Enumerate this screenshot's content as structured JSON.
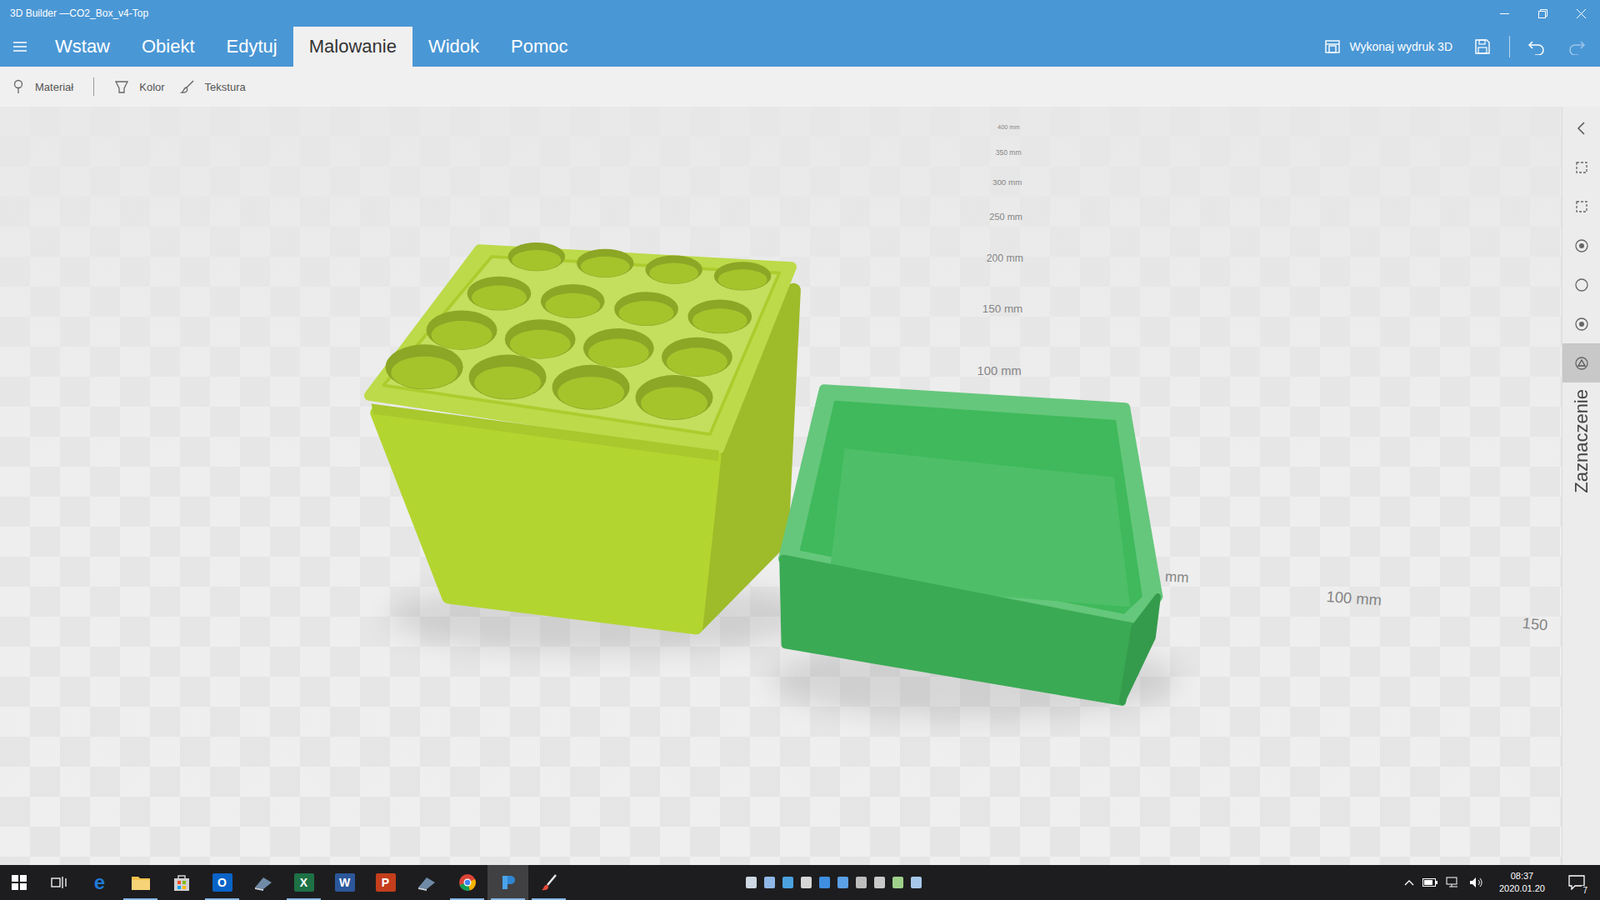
{
  "window": {
    "title": "3D Builder —CO2_Box_v4-Top"
  },
  "menu": {
    "tabs": [
      {
        "label": "Wstaw",
        "selected": false
      },
      {
        "label": "Obiekt",
        "selected": false
      },
      {
        "label": "Edytuj",
        "selected": false
      },
      {
        "label": "Malowanie",
        "selected": true
      },
      {
        "label": "Widok",
        "selected": false
      },
      {
        "label": "Pomoc",
        "selected": false
      }
    ],
    "print_button": "Wykonaj wydruk 3D",
    "undo": {
      "disabled": false
    },
    "redo": {
      "disabled": true
    }
  },
  "toolbar": {
    "items": [
      {
        "label": "Materiał"
      },
      {
        "label": "Kolor"
      },
      {
        "label": "Tekstura"
      }
    ]
  },
  "rulers": {
    "vertical": [
      "400 mm",
      "350 mm",
      "300 mm",
      "250 mm",
      "200 mm",
      "150 mm",
      "100 mm"
    ],
    "horizontal": [
      "mm",
      "100 mm",
      "150"
    ]
  },
  "scene": {
    "objects": [
      {
        "kind": "holder",
        "color": "#b3d530",
        "rows": 4,
        "cols": 4
      },
      {
        "kind": "lid",
        "color": "#3fb95b"
      }
    ]
  },
  "side_panel": {
    "tools": [
      {
        "selected": false
      },
      {
        "selected": false
      },
      {
        "selected": false
      },
      {
        "selected": false
      },
      {
        "selected": false
      },
      {
        "selected": true
      }
    ],
    "label": "Zaznaczenie"
  },
  "taskbar": {
    "apps": [
      {
        "kind": "windows",
        "running": false,
        "active": false
      },
      {
        "kind": "taskview",
        "running": false,
        "active": false
      },
      {
        "kind": "edge",
        "glyph": "e",
        "color": "#1f7ad6",
        "running": false,
        "active": false
      },
      {
        "kind": "folder",
        "running": true,
        "active": false
      },
      {
        "kind": "store",
        "running": false,
        "active": false
      },
      {
        "kind": "letter",
        "glyph": "O",
        "color": "#0a64c8",
        "running": true,
        "active": false
      },
      {
        "kind": "app",
        "running": false,
        "active": false
      },
      {
        "kind": "letter",
        "glyph": "X",
        "color": "#1e7145",
        "running": true,
        "active": false
      },
      {
        "kind": "letter",
        "glyph": "W",
        "color": "#2b579a",
        "running": false,
        "active": false
      },
      {
        "kind": "letter",
        "glyph": "P",
        "color": "#c43e1c",
        "running": false,
        "active": false
      },
      {
        "kind": "app",
        "running": false,
        "active": false
      },
      {
        "kind": "chrome",
        "running": true,
        "active": false
      },
      {
        "kind": "builder",
        "running": true,
        "active": true
      },
      {
        "kind": "paint",
        "running": true,
        "active": false
      }
    ],
    "clock": {
      "time": "08:37",
      "date": "2020.01.20"
    },
    "notifications": "7"
  }
}
